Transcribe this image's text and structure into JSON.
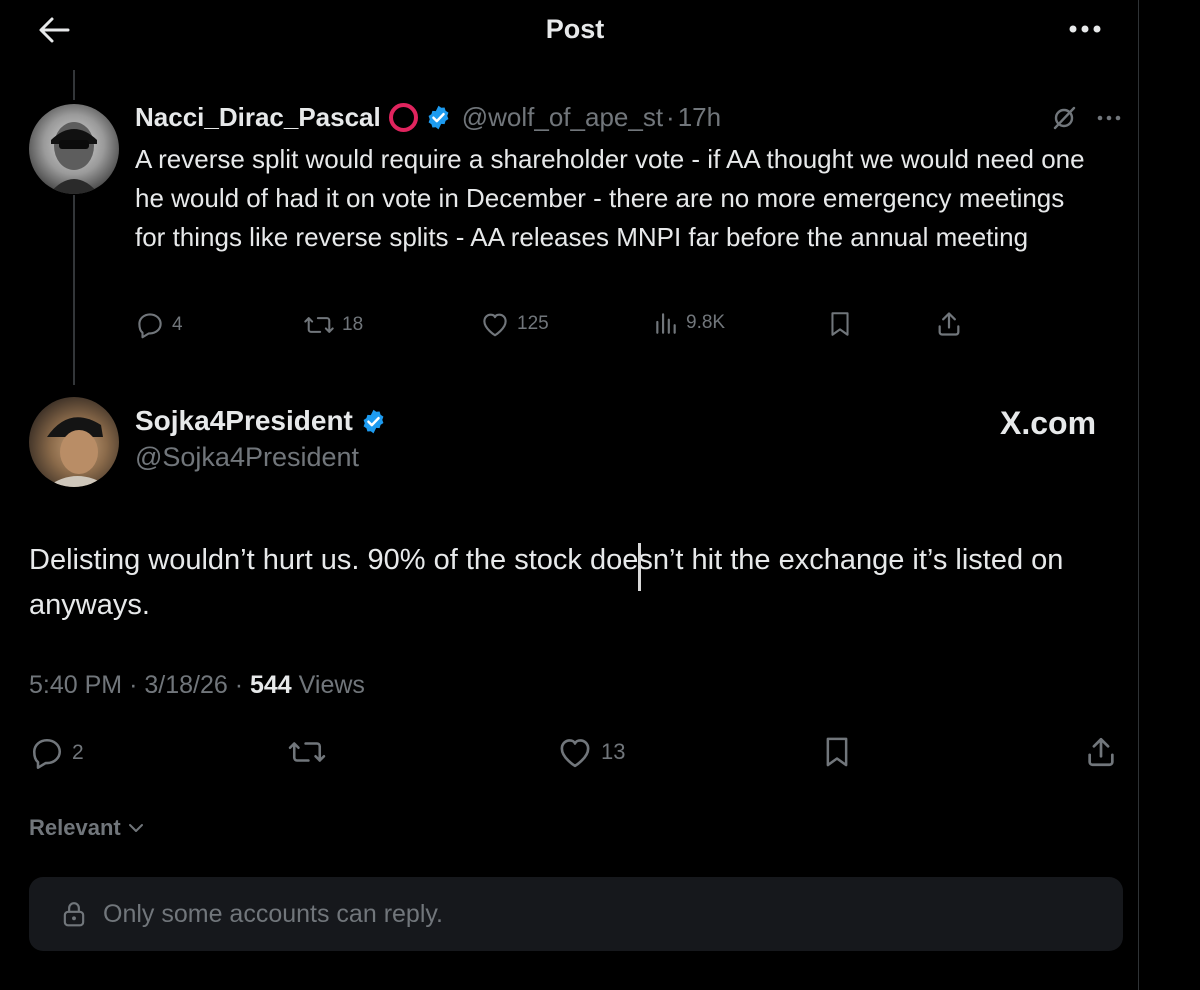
{
  "header": {
    "title": "Post"
  },
  "parent_post": {
    "display_name": "Nacci_Dirac_Pascal",
    "handle": "@wolf_of_ape_st",
    "separator": "·",
    "time": "17h",
    "text": "A reverse split would require a shareholder vote - if AA thought we would need one he would of had it on vote in December - there are no more emergency meetings for things like reverse splits - AA releases MNPI far before the annual meeting",
    "replies": "4",
    "reposts": "18",
    "likes": "125",
    "views": "9.8K",
    "icons": [
      "reply-icon",
      "repost-icon",
      "like-icon",
      "views-icon",
      "bookmark-icon",
      "share-icon"
    ]
  },
  "main_post": {
    "display_name": "Sojka4President",
    "handle": "@Sojka4President",
    "watermark": "X.com",
    "text": "Delisting wouldn’t hurt us.  90% of the stock doesn’t hit the exchange it’s listed on anyways.",
    "time": "5:40 PM",
    "date": "3/18/26",
    "views_count": "544",
    "views_label": "Views",
    "replies": "2",
    "likes": "13"
  },
  "sort": {
    "label": "Relevant"
  },
  "reply_restriction": {
    "text": "Only some accounts can reply."
  },
  "colors": {
    "background": "#000000",
    "text": "#e7e9ea",
    "muted": "#71767b",
    "verified": "#1d9bf0",
    "red_ring": "#e0245e",
    "reply_box": "#16181c"
  }
}
